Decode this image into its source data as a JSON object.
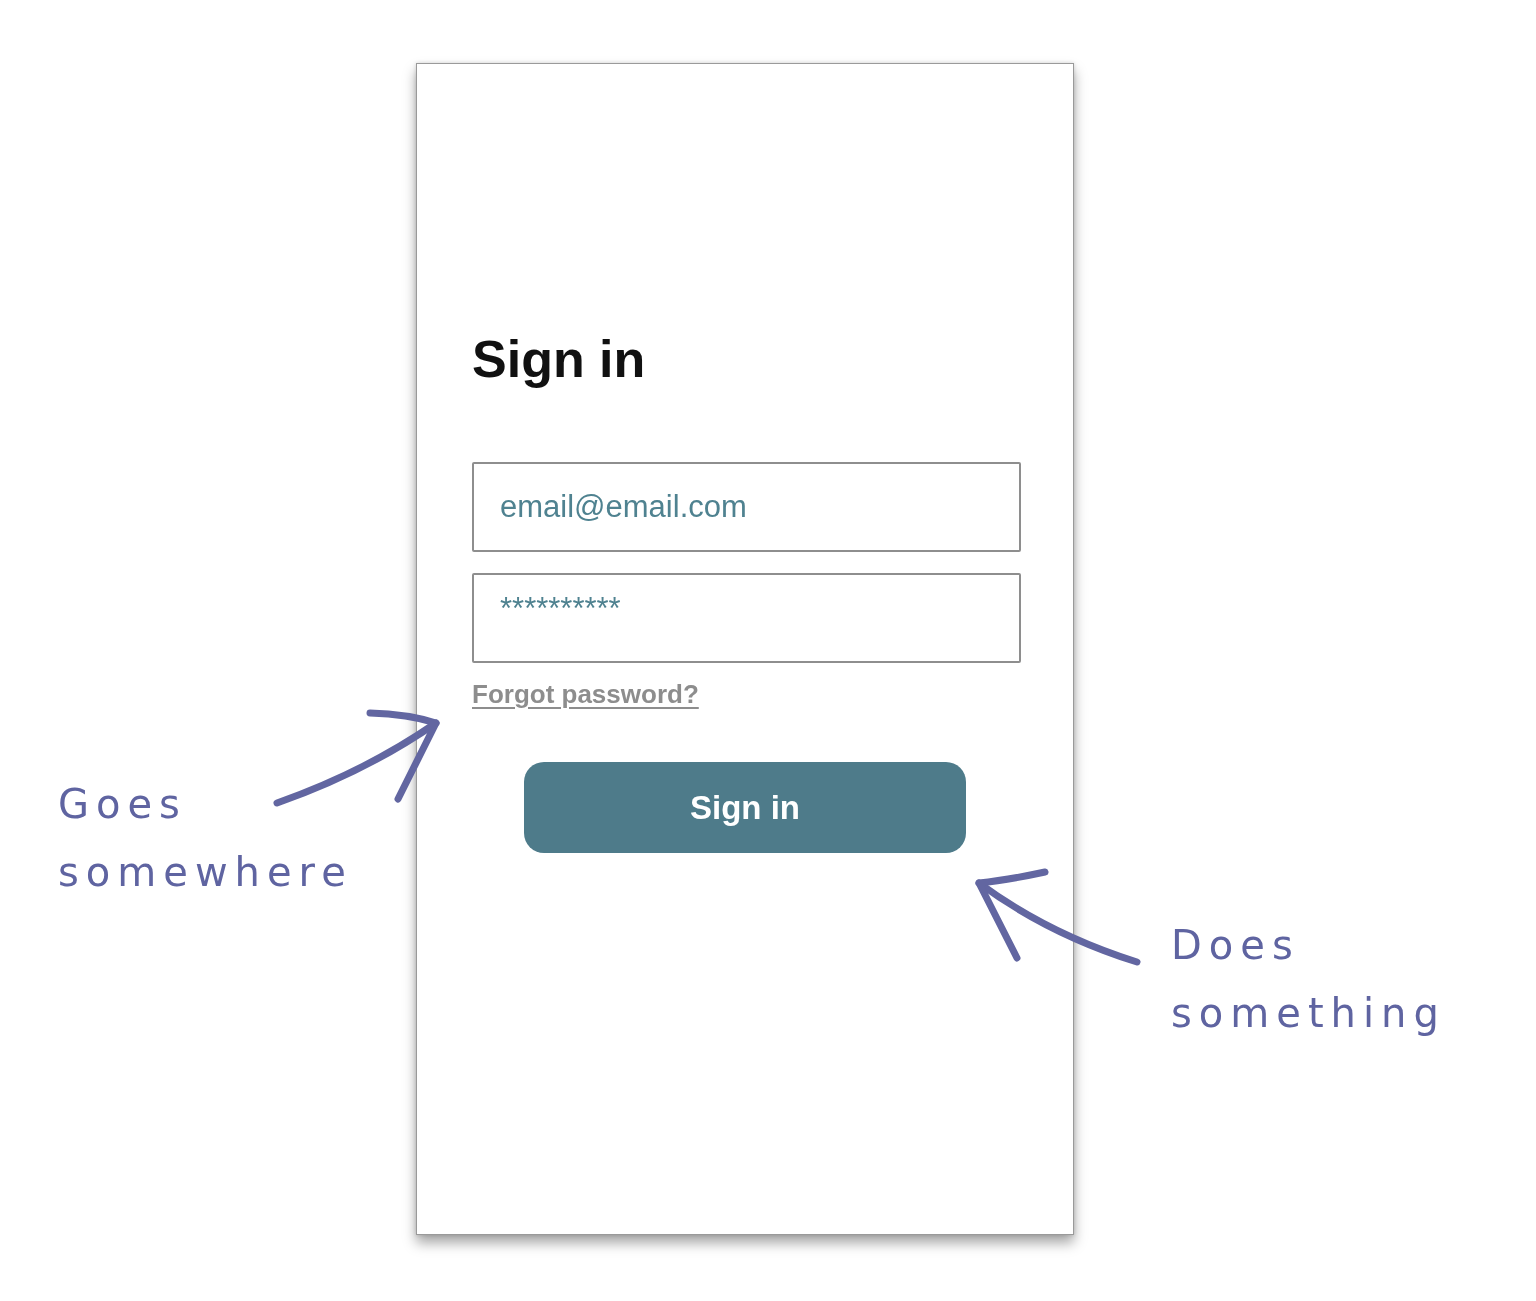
{
  "login_screen": {
    "title": "Sign in",
    "fields": [
      {
        "kind": "email",
        "value": "email@email.com"
      },
      {
        "kind": "password",
        "value": "**********"
      }
    ],
    "forgot_link": "Forgot password?",
    "submit_button": "Sign in"
  },
  "annotations": [
    {
      "text": "Goes somewhere"
    },
    {
      "text": "Does something"
    }
  ]
}
